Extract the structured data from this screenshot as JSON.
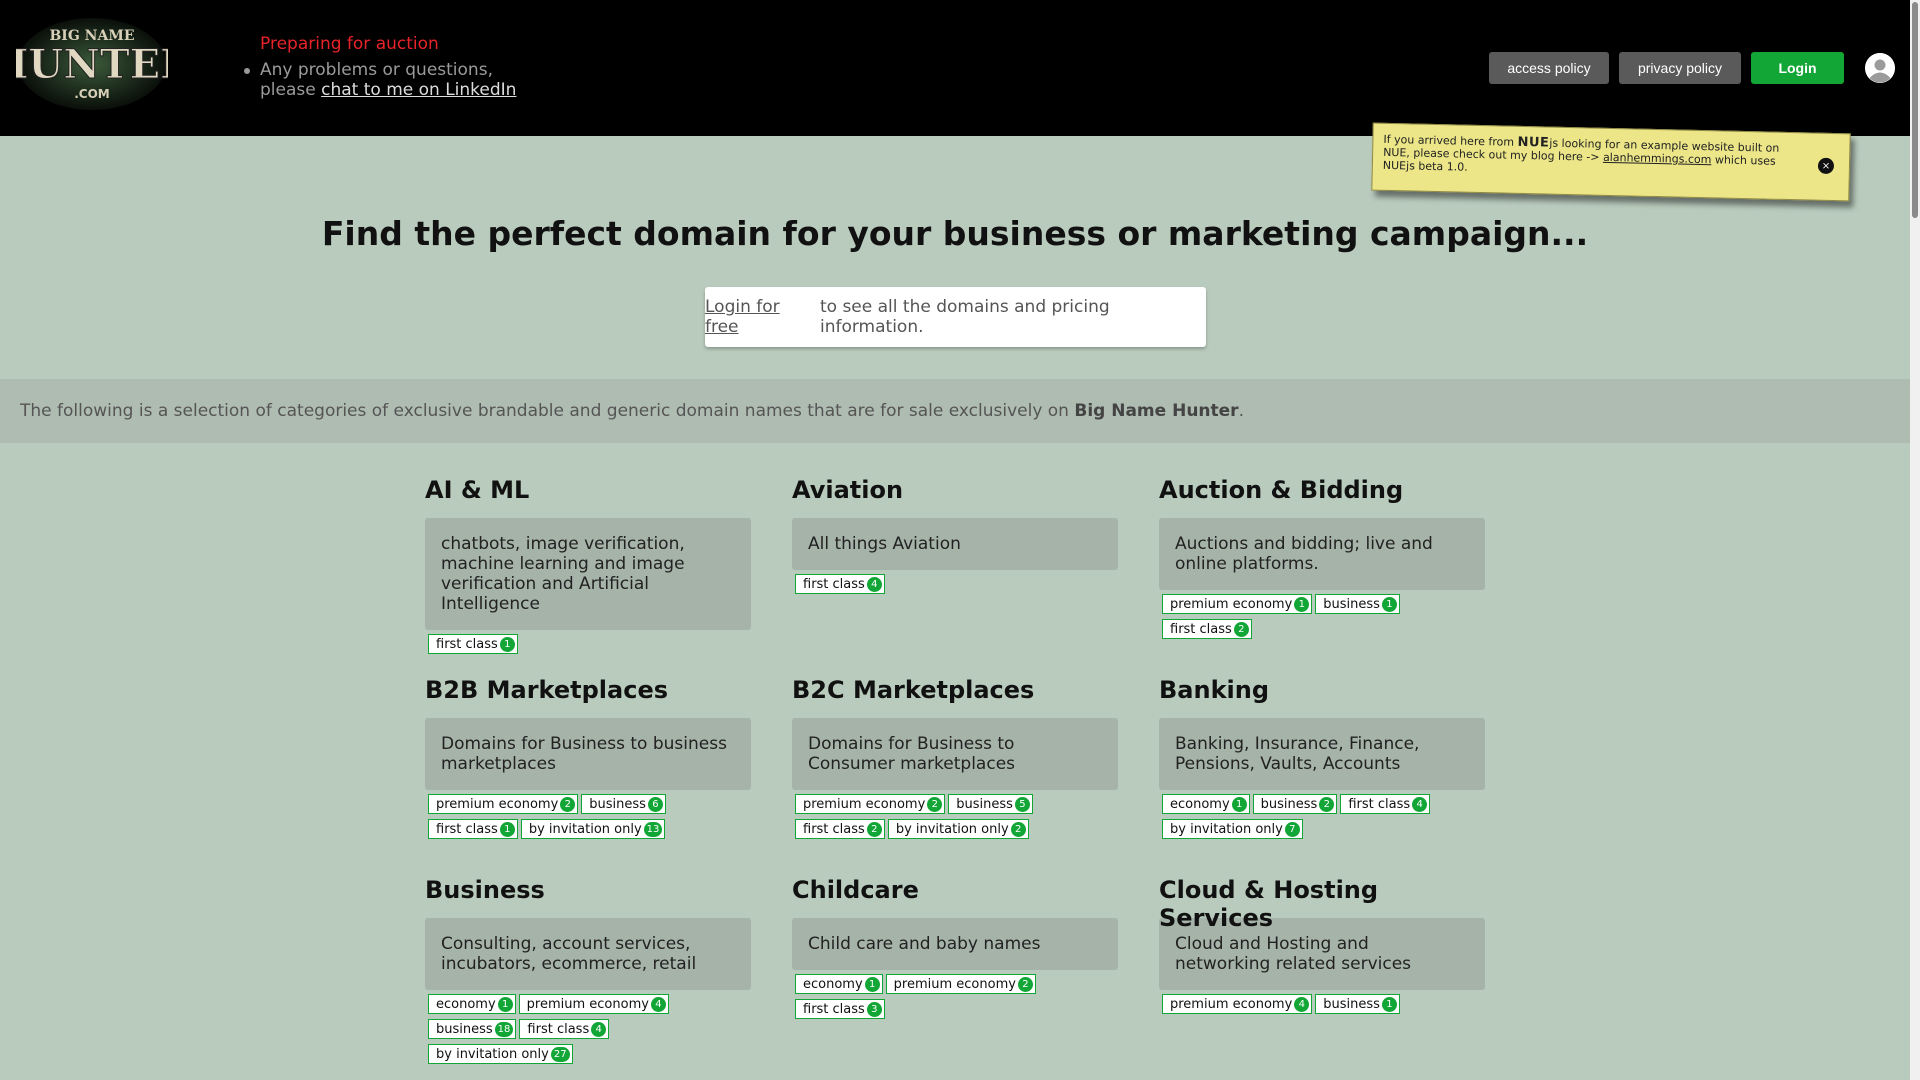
{
  "header": {
    "logo": {
      "line1": "BIG NAME",
      "line2": "HUNTER",
      "line3": ".COM"
    },
    "status": "Preparing for auction",
    "help_prefix": "Any problems or questions,",
    "help_please": "please",
    "help_link": "chat to me on LinkedIn",
    "nav": {
      "access": "access policy",
      "privacy": "privacy policy",
      "login": "Login"
    },
    "colors": {
      "login": "#12a637",
      "status": "#e8232a"
    }
  },
  "note": {
    "prefix": "If you arrived here from",
    "brand": "NUE",
    "mid": "js looking for an example website built on NUE, please check out my blog here ->",
    "link": "alanhemmings.com",
    "suffix": "which uses NUEjs beta 1.0.",
    "close": "×"
  },
  "hero": {
    "title": "Find the perfect domain for your business or marketing campaign...",
    "login_link": "Login for free",
    "login_text": "to see all the domains and pricing information."
  },
  "intro": {
    "text": "The following is a selection of categories of exclusive brandable and generic domain names that are for sale exclusively on",
    "brand": "Big Name Hunter",
    "end": "."
  },
  "categories": [
    {
      "title": "AI & ML",
      "desc": "chatbots, image verification, machine learning and image verification and Artificial Intelligence",
      "tags": [
        {
          "label": "first class",
          "count": "1"
        }
      ]
    },
    {
      "title": "Aviation",
      "desc": "All things Aviation",
      "tags": [
        {
          "label": "first class",
          "count": "4"
        }
      ]
    },
    {
      "title": "Auction & Bidding",
      "desc": "Auctions and bidding; live and online platforms.",
      "tags": [
        {
          "label": "premium economy",
          "count": "1"
        },
        {
          "label": "business",
          "count": "1"
        },
        {
          "label": "first class",
          "count": "2"
        }
      ]
    },
    {
      "title": "B2B Marketplaces",
      "desc": "Domains for Business to business marketplaces",
      "tags": [
        {
          "label": "premium economy",
          "count": "2"
        },
        {
          "label": "business",
          "count": "6"
        },
        {
          "label": "first class",
          "count": "1"
        },
        {
          "label": "by invitation only",
          "count": "13"
        }
      ]
    },
    {
      "title": "B2C Marketplaces",
      "desc": "Domains for Business to Consumer marketplaces",
      "tags": [
        {
          "label": "premium economy",
          "count": "2"
        },
        {
          "label": "business",
          "count": "5"
        },
        {
          "label": "first class",
          "count": "2"
        },
        {
          "label": "by invitation only",
          "count": "2"
        }
      ]
    },
    {
      "title": "Banking",
      "desc": "Banking, Insurance, Finance, Pensions, Vaults, Accounts",
      "tags": [
        {
          "label": "economy",
          "count": "1"
        },
        {
          "label": "business",
          "count": "2"
        },
        {
          "label": "first class",
          "count": "4"
        },
        {
          "label": "by invitation only",
          "count": "7"
        }
      ]
    },
    {
      "title": "Business",
      "desc": "Consulting, account services, incubators, ecommerce, retail",
      "tags": [
        {
          "label": "economy",
          "count": "1"
        },
        {
          "label": "premium economy",
          "count": "4"
        },
        {
          "label": "business",
          "count": "18"
        },
        {
          "label": "first class",
          "count": "4"
        },
        {
          "label": "by invitation only",
          "count": "27"
        }
      ]
    },
    {
      "title": "Childcare",
      "desc": "Child care and baby names",
      "tags": [
        {
          "label": "economy",
          "count": "1"
        },
        {
          "label": "premium economy",
          "count": "2"
        },
        {
          "label": "first class",
          "count": "3"
        }
      ]
    },
    {
      "title": "Cloud & Hosting Services",
      "desc": "Cloud and Hosting and networking related services",
      "tags": [
        {
          "label": "premium economy",
          "count": "4"
        },
        {
          "label": "business",
          "count": "1"
        }
      ]
    }
  ]
}
